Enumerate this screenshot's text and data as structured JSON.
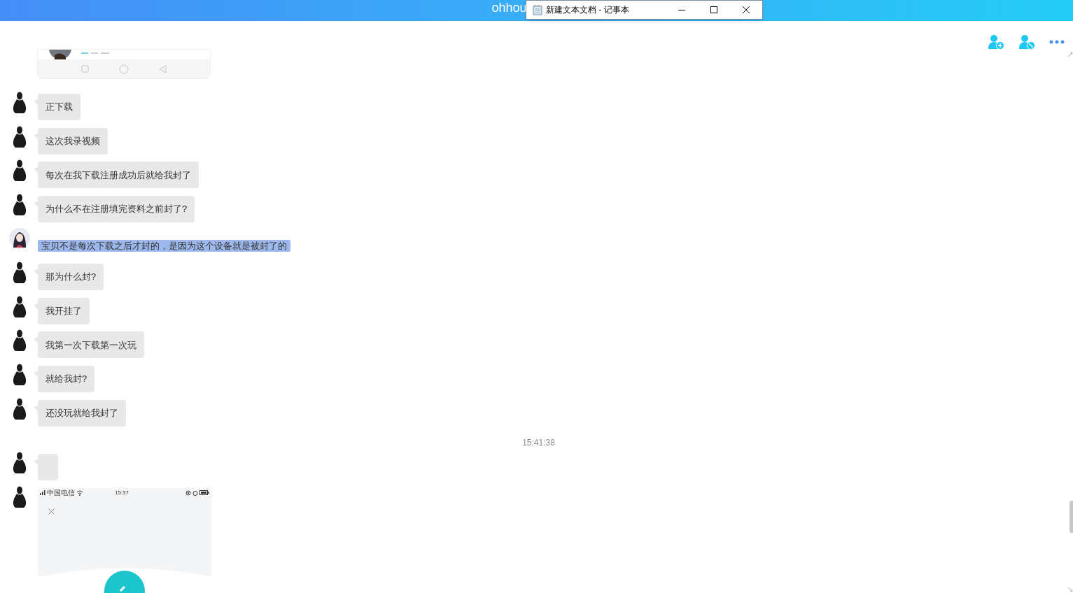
{
  "app": {
    "title": "ohhou"
  },
  "notepad": {
    "title": "新建文本文档 - 记事本"
  },
  "messages": [
    {
      "kind": "nav-image"
    },
    {
      "kind": "text",
      "avatar": {
        "kind": "silhouette"
      },
      "text": "正下载",
      "selected": false
    },
    {
      "kind": "text",
      "avatar": {
        "kind": "silhouette"
      },
      "text": "这次我录视频",
      "selected": false
    },
    {
      "kind": "text",
      "avatar": {
        "kind": "silhouette"
      },
      "text": "每次在我下载注册成功后就给我封了",
      "selected": false
    },
    {
      "kind": "text",
      "avatar": {
        "kind": "silhouette"
      },
      "text": "为什么不在注册填完资料之前封了?",
      "selected": false
    },
    {
      "kind": "text",
      "avatar": {
        "kind": "portrait"
      },
      "text": "宝贝不是每次下载之后才封的，是因为这个设备就是被封了的",
      "selected": true
    },
    {
      "kind": "text",
      "avatar": {
        "kind": "silhouette"
      },
      "text": "那为什么封?",
      "selected": false
    },
    {
      "kind": "text",
      "avatar": {
        "kind": "silhouette"
      },
      "text": "我开挂了",
      "selected": false
    },
    {
      "kind": "text",
      "avatar": {
        "kind": "silhouette"
      },
      "text": "我第一次下载第一次玩",
      "selected": false
    },
    {
      "kind": "text",
      "avatar": {
        "kind": "silhouette"
      },
      "text": "就给我封?",
      "selected": false
    },
    {
      "kind": "text",
      "avatar": {
        "kind": "silhouette"
      },
      "text": "还没玩就给我封了",
      "selected": false
    },
    {
      "kind": "time",
      "text": "15:41:38"
    },
    {
      "kind": "empty",
      "avatar": {
        "kind": "silhouette"
      }
    },
    {
      "kind": "phone-image",
      "avatar": {
        "kind": "silhouette"
      },
      "carrier": "中国电信",
      "clock": "15:37"
    }
  ]
}
